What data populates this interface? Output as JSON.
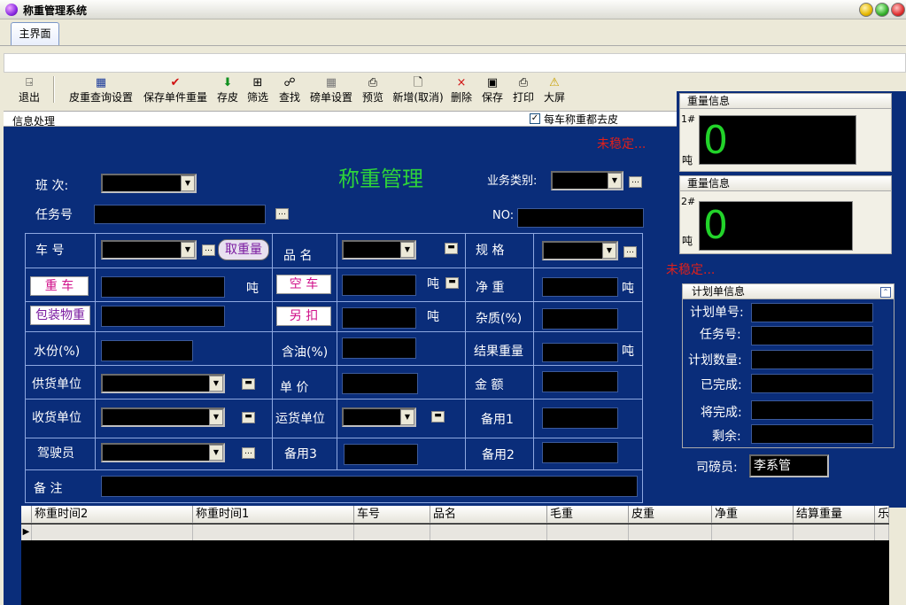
{
  "window": {
    "title": "称重管理系统"
  },
  "tabs": [
    {
      "label": "主界面"
    }
  ],
  "toolbar": {
    "exit": "退出",
    "tare_query": "皮重查询设置",
    "save_single_weight": "保存单件重量",
    "save_tare": "存皮",
    "filter": "筛选",
    "search": "查找",
    "ticket_settings": "磅单设置",
    "preview": "预览",
    "new_cancel": "新增(取消)",
    "delete": "删除",
    "save": "保存",
    "print": "打印",
    "big_screen": "大屏"
  },
  "infobar": {
    "label": "信息处理",
    "tare_each_label": "每车称重都去皮",
    "tare_each_checked": "✓"
  },
  "form": {
    "heading": "称重管理",
    "unstable_1": "未稳定...",
    "shift": "班 次:",
    "business_type": "业务类别:",
    "task_no": "任务号",
    "no": "NO:",
    "vehicle_no": "车 号",
    "get_weight": "取重量",
    "product": "品 名",
    "spec": "规 格",
    "heavy_vehicle": "重 车",
    "ton_1": "吨",
    "empty_vehicle": "空 车",
    "ton_2": "吨",
    "net_weight": "净 重",
    "ton_3": "吨",
    "package_weight": "包装物重",
    "extra_deduct": "另 扣",
    "ton_4": "吨",
    "impurity": "杂质(%)",
    "moisture": "水份(%)",
    "oil_content": "含油(%)",
    "result_weight": "结果重量",
    "ton_5": "吨",
    "supplier": "供货单位",
    "unit_price": "单 价",
    "amount": "金 额",
    "receiver": "收货单位",
    "carrier": "运货单位",
    "spare1": "备用1",
    "driver": "驾驶员",
    "spare3": "备用3",
    "spare2": "备用2",
    "remark": "备 注"
  },
  "scale1": {
    "title": "重量信息",
    "id": "1#",
    "unit": "吨",
    "value": "0"
  },
  "scale2": {
    "title": "重量信息",
    "id": "2#",
    "unit": "吨",
    "value": "0"
  },
  "unstable_2": "未稳定...",
  "plan": {
    "title": "计划单信息",
    "plan_no": "计划单号:",
    "task_no": "任务号:",
    "plan_qty": "计划数量:",
    "completed": "已完成:",
    "to_complete": "将完成:",
    "remaining": "剩余:"
  },
  "operator": {
    "label": "司磅员:",
    "value": "李系管"
  },
  "grid": {
    "columns": [
      "称重时间2",
      "称重时间1",
      "车号",
      "品名",
      "毛重",
      "皮重",
      "净重",
      "结算重量",
      "乐"
    ]
  }
}
